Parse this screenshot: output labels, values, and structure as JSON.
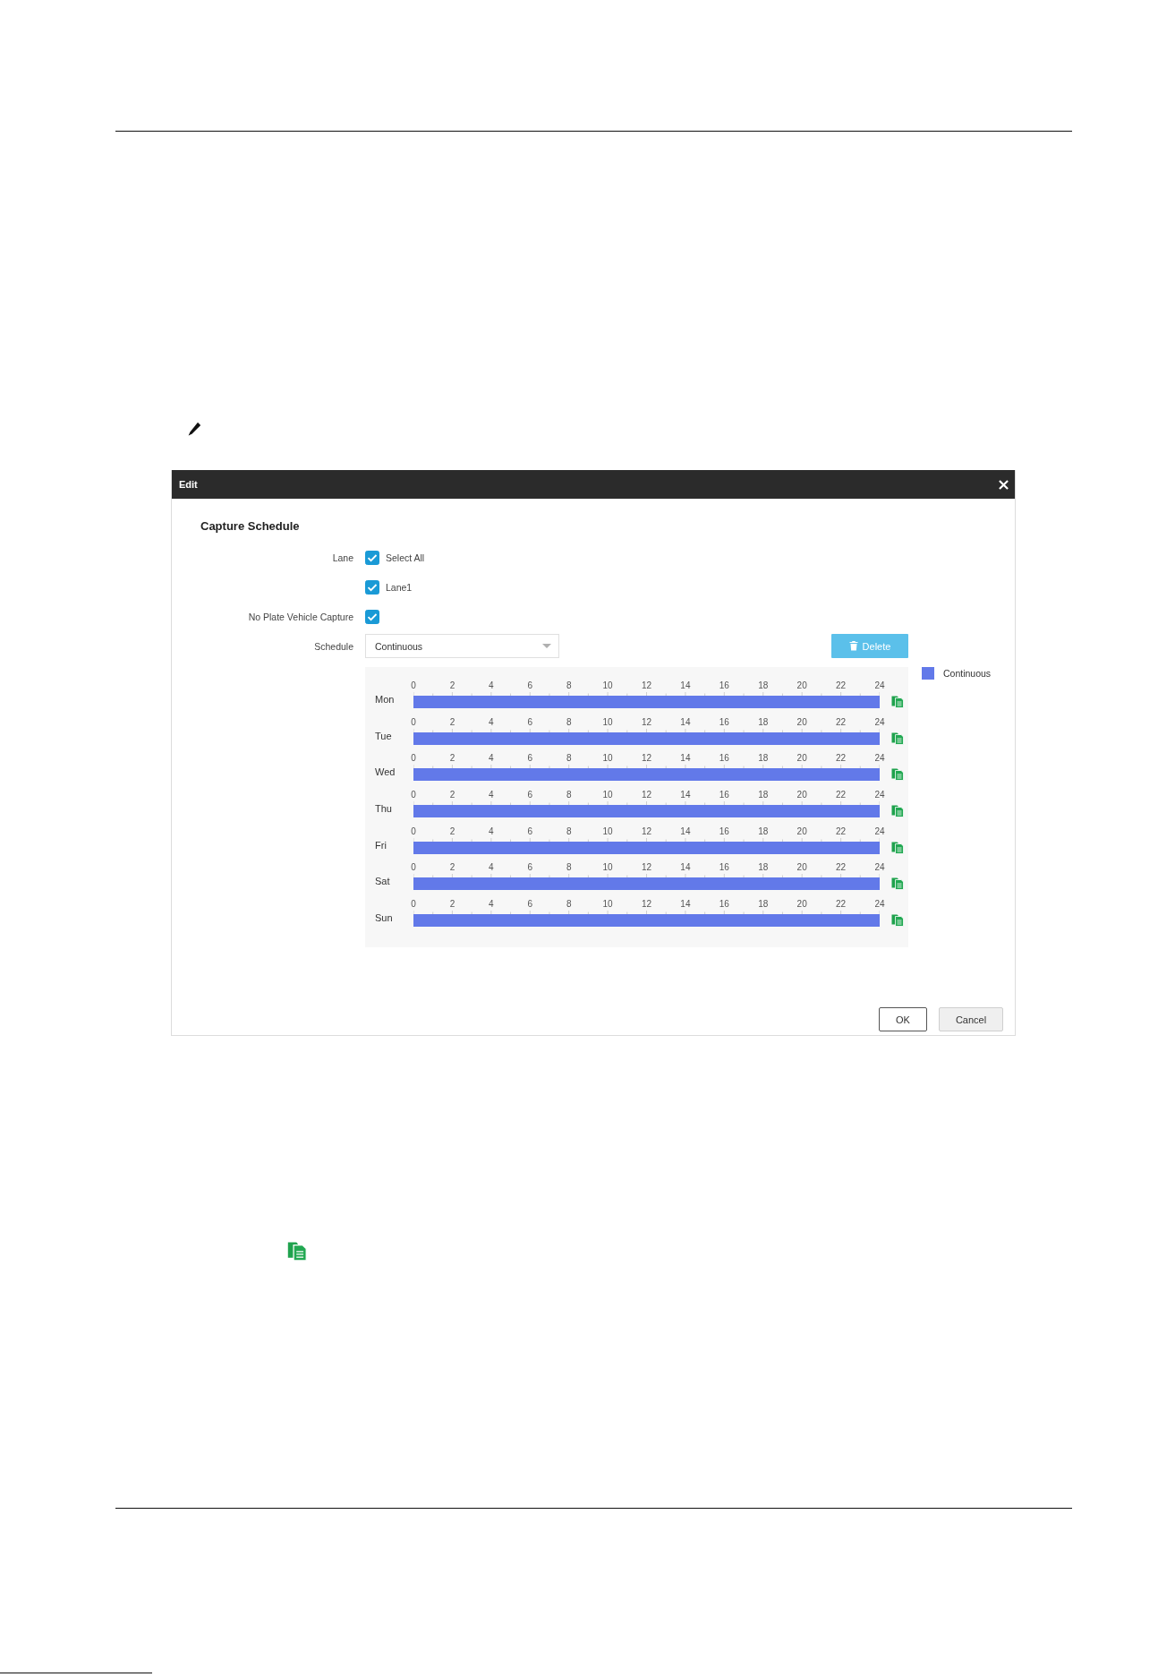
{
  "dialog": {
    "title": "Edit",
    "section_title": "Capture Schedule",
    "fields": [
      {
        "kind": "checkbox_group",
        "label": "Lane",
        "options": [
          {
            "label": "Select All",
            "checked": true
          },
          {
            "label": "Lane1",
            "checked": true
          }
        ]
      },
      {
        "kind": "checkbox",
        "label": "No Plate Vehicle Capture",
        "checked": true
      },
      {
        "kind": "select",
        "label": "Schedule",
        "value": "Continuous"
      }
    ],
    "delete_button": "Delete",
    "legend": [
      {
        "label": "Continuous",
        "color": "#6279e9"
      }
    ],
    "days": [
      {
        "day": "Mon",
        "ticks": [
          "0",
          "2",
          "4",
          "6",
          "8",
          "10",
          "12",
          "14",
          "16",
          "18",
          "20",
          "22",
          "24"
        ],
        "level": 1
      },
      {
        "day": "Tue",
        "ticks": [
          "0",
          "2",
          "4",
          "6",
          "8",
          "10",
          "12",
          "14",
          "16",
          "18",
          "20",
          "22",
          "24"
        ],
        "level": 1
      },
      {
        "day": "Wed",
        "ticks": [
          "0",
          "2",
          "4",
          "6",
          "8",
          "10",
          "12",
          "14",
          "16",
          "18",
          "20",
          "22",
          "24"
        ],
        "level": 1
      },
      {
        "day": "Thu",
        "ticks": [
          "0",
          "2",
          "4",
          "6",
          "8",
          "10",
          "12",
          "14",
          "16",
          "18",
          "20",
          "22",
          "24"
        ],
        "level": 1
      },
      {
        "day": "Fri",
        "ticks": [
          "0",
          "2",
          "4",
          "6",
          "8",
          "10",
          "12",
          "14",
          "16",
          "18",
          "20",
          "22",
          "24"
        ],
        "level": 1
      },
      {
        "day": "Sat",
        "ticks": [
          "0",
          "2",
          "4",
          "6",
          "8",
          "10",
          "12",
          "14",
          "16",
          "18",
          "20",
          "22",
          "24"
        ],
        "level": 1
      },
      {
        "day": "Sun",
        "ticks": [
          "0",
          "2",
          "4",
          "6",
          "8",
          "10",
          "12",
          "14",
          "16",
          "18",
          "20",
          "22",
          "24"
        ],
        "level": 1
      }
    ],
    "buttons": [
      {
        "label": "OK",
        "kind": "primary"
      },
      {
        "label": "Cancel",
        "kind": "secondary"
      }
    ]
  }
}
